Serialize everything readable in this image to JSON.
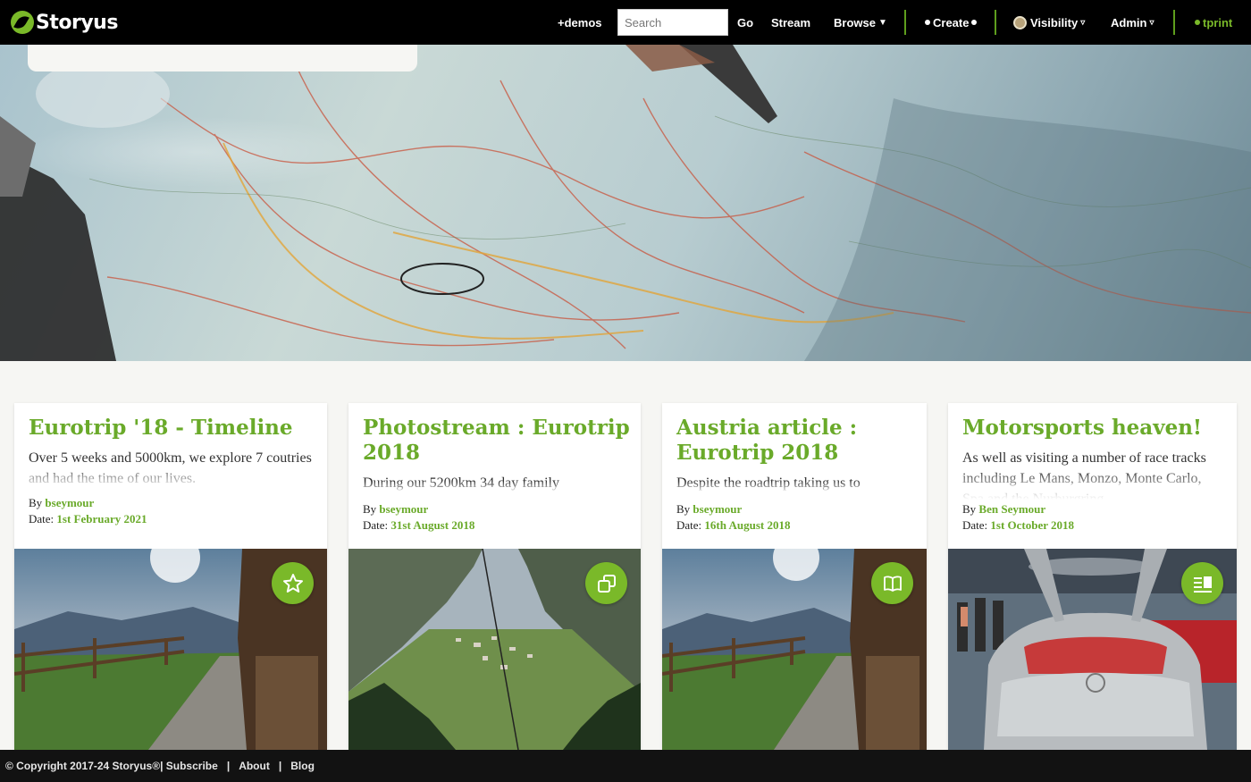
{
  "brand": {
    "name": "Storyus"
  },
  "nav": {
    "demos": "+demos",
    "search_placeholder": "Search",
    "go": "Go",
    "stream": "Stream",
    "browse": "Browse",
    "create": "Create",
    "visibility": "Visibility",
    "admin": "Admin",
    "user": "tprint"
  },
  "cards": [
    {
      "title": "Eurotrip '18 - Timeline",
      "excerpt": "Over 5 weeks and 5000km, we explore 7 coutries and had the time of our lives.",
      "by_label": "By",
      "author": "bseymour",
      "date_label": "Date:",
      "date": "1st February 2021",
      "badge_icon": "star-icon"
    },
    {
      "title": "Photostream : Eurotrip 2018",
      "excerpt": "During our 5200km 34 day family",
      "by_label": "By",
      "author": "bseymour",
      "date_label": "Date:",
      "date": "31st August 2018",
      "badge_icon": "gallery-icon"
    },
    {
      "title": "Austria article : Eurotrip 2018",
      "excerpt": "Despite the roadtrip taking us to",
      "by_label": "By",
      "author": "bseymour",
      "date_label": "Date:",
      "date": "16th August 2018",
      "badge_icon": "book-icon"
    },
    {
      "title": "Motorsports heaven!",
      "excerpt": "As well as visiting a number of race tracks including Le Mans, Monzo, Monte Carlo, Spa and the Nurburgring",
      "by_label": "By",
      "author": "Ben Seymour",
      "date_label": "Date:",
      "date": "1st October 2018",
      "badge_icon": "article-icon"
    }
  ],
  "footer": {
    "copyright": "© Copyright 2017-24 Storyus®",
    "subscribe": "Subscribe",
    "about": "About",
    "blog": "Blog",
    "sep": "|"
  },
  "colors": {
    "accent": "#7ab929",
    "title": "#6aaa2a",
    "nav_bg": "#000000",
    "footer_bg": "#121212"
  }
}
